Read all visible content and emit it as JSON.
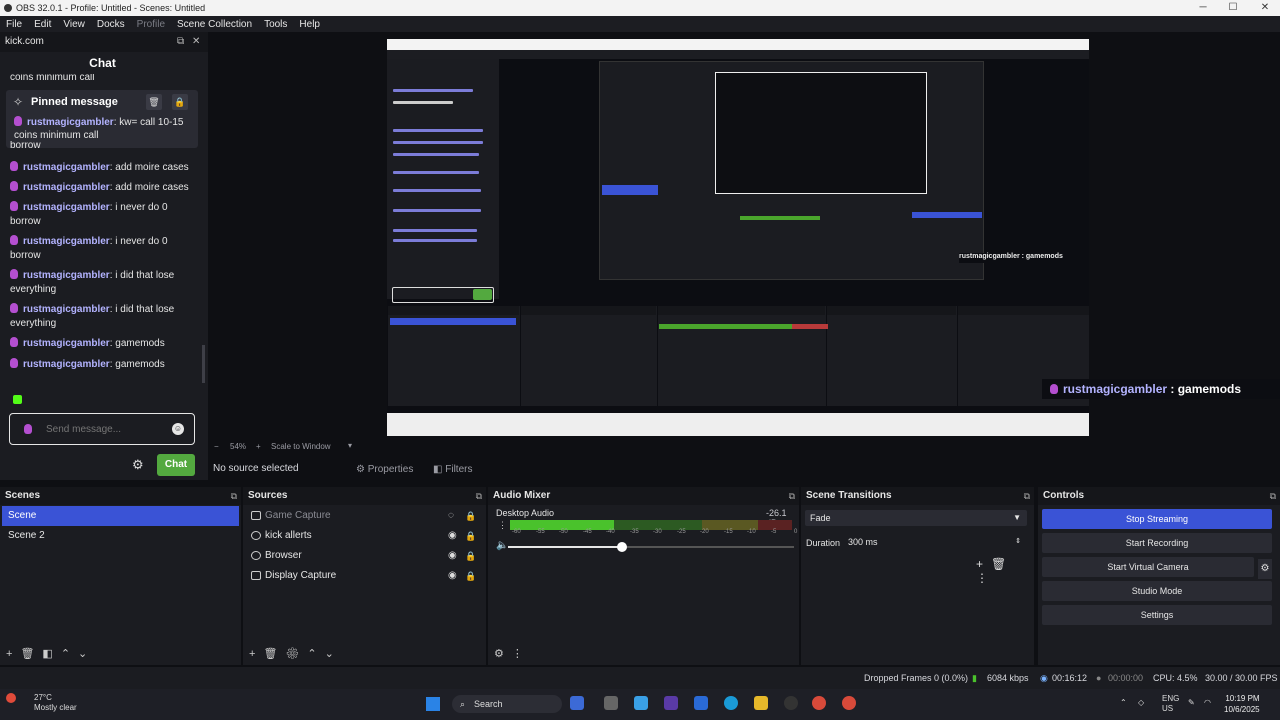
{
  "window": {
    "title": "OBS 32.0.1 - Profile: Untitled - Scenes: Untitled",
    "controls": [
      "─",
      "☐",
      "✕"
    ]
  },
  "menubar": {
    "items": [
      "File",
      "Edit",
      "View",
      "Docks",
      "Profile",
      "Scene Collection",
      "Tools",
      "Help"
    ]
  },
  "chat_dock": {
    "title": "kick.com",
    "chat_heading": "Chat",
    "partial_top": "coins minimum call",
    "pinned": {
      "title": "Pinned message",
      "user": "rustmagicgambler",
      "text": ": kw= call 10-15 coins minimum call"
    },
    "partial_after_pinned": "borrow",
    "messages": [
      {
        "user": "rustmagicgambler",
        "text": ": add moire cases"
      },
      {
        "user": "rustmagicgambler",
        "text": ": add moire cases"
      },
      {
        "user": "rustmagicgambler",
        "text": ": i never do 0 borrow"
      },
      {
        "user": "rustmagicgambler",
        "text": ": i never do 0 borrow"
      },
      {
        "user": "rustmagicgambler",
        "text": ": i did that lose everything"
      },
      {
        "user": "rustmagicgambler",
        "text": ": i did that lose everything"
      },
      {
        "user": "rustmagicgambler",
        "text": ": gamemods"
      },
      {
        "user": "rustmagicgambler",
        "text": ": gamemods"
      }
    ],
    "send_placeholder": "Send message...",
    "chat_button": "Chat"
  },
  "overlay": {
    "user": "rustmagicgambler",
    "text": " : gamemods"
  },
  "preview_toolbar": {
    "zoom": "54%",
    "scale_mode": "Scale to Window"
  },
  "source_toolbar": {
    "no_source": "No source selected",
    "properties": "Properties",
    "filters": "Filters"
  },
  "scenes": {
    "title": "Scenes",
    "items": [
      "Scene",
      "Scene 2"
    ],
    "selected": "Scene"
  },
  "sources": {
    "title": "Sources",
    "items": [
      {
        "name": "Game Capture",
        "visible": false
      },
      {
        "name": "kick allerts",
        "visible": true
      },
      {
        "name": "Browser",
        "visible": true
      },
      {
        "name": "Display Capture",
        "visible": true
      }
    ]
  },
  "audio_mixer": {
    "title": "Audio Mixer",
    "track": "Desktop Audio",
    "db": "-26.1 dB",
    "ticks": [
      "-60",
      "-55",
      "-50",
      "-45",
      "-40",
      "-35",
      "-30",
      "-25",
      "-20",
      "-15",
      "-10",
      "-5",
      "0"
    ],
    "meter_level": 0.37,
    "volume": 0.4
  },
  "transitions": {
    "title": "Scene Transitions",
    "selected": "Fade",
    "duration_label": "Duration",
    "duration_value": "300 ms"
  },
  "controls": {
    "title": "Controls",
    "buttons": [
      "Stop Streaming",
      "Start Recording",
      "Start Virtual Camera",
      "Studio Mode",
      "Settings"
    ]
  },
  "statusbar": {
    "dropped": "Dropped Frames 0 (0.0%)",
    "bitrate": "6084 kbps",
    "stream_time": "00:16:12",
    "rec_time": "00:00:00",
    "cpu": "CPU: 4.5%",
    "fps": "30.00 / 30.00 FPS"
  },
  "taskbar": {
    "weather_temp": "27°C",
    "weather_desc": "Mostly clear",
    "search": "Search",
    "lang": "ENG",
    "region": "US",
    "time": "10:19 PM",
    "date": "10/6/2025"
  },
  "colors": {
    "accent": "#3a53d6",
    "kick_green": "#53fc18",
    "username": "#b3b3ff",
    "meter_green": "#4aa52c"
  }
}
